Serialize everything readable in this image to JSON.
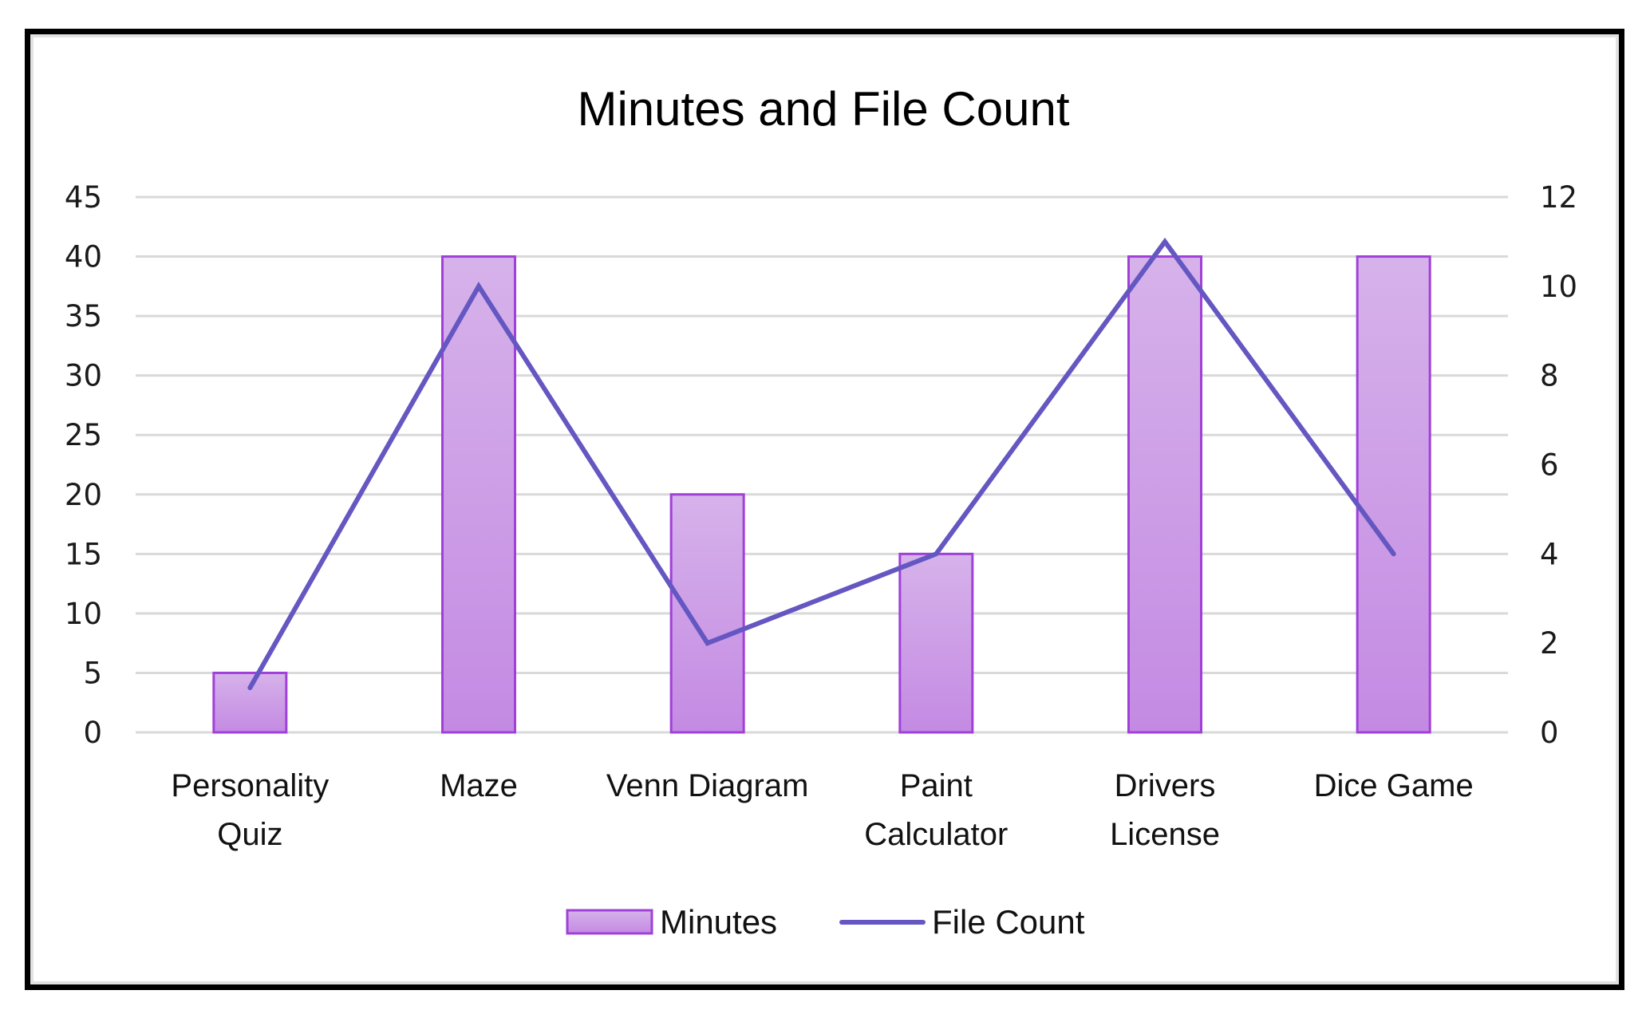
{
  "chart_data": {
    "type": "bar",
    "title": "Minutes and File Count",
    "categories": [
      "Personality Quiz",
      "Maze",
      "Venn Diagram",
      "Paint Calculator",
      "Drivers License",
      "Dice Game"
    ],
    "category_lines": [
      [
        "Personality",
        "Quiz"
      ],
      [
        "Maze"
      ],
      [
        "Venn Diagram"
      ],
      [
        "Paint",
        "Calculator"
      ],
      [
        "Drivers",
        "License"
      ],
      [
        "Dice Game"
      ]
    ],
    "series": [
      {
        "name": "Minutes",
        "type": "bar",
        "axis": "left",
        "values": [
          5,
          40,
          20,
          15,
          40,
          40
        ],
        "color": "#C994E6",
        "border_color": "#A040D8"
      },
      {
        "name": "File Count",
        "type": "line",
        "axis": "right",
        "values": [
          1,
          10,
          2,
          4,
          11,
          4
        ],
        "color": "#6457C2"
      }
    ],
    "left_axis": {
      "min": 0,
      "max": 45,
      "step": 5,
      "ticks": [
        "0",
        "5",
        "10",
        "15",
        "20",
        "25",
        "30",
        "35",
        "40",
        "45"
      ]
    },
    "right_axis": {
      "min": 0,
      "max": 12,
      "step": 2,
      "ticks": [
        "0",
        "2",
        "4",
        "6",
        "8",
        "10",
        "12"
      ]
    },
    "xlabel": "",
    "ylabel": "",
    "grid": true,
    "legend_position": "bottom",
    "legend": [
      {
        "label": "Minutes",
        "kind": "bar"
      },
      {
        "label": "File Count",
        "kind": "line"
      }
    ]
  }
}
